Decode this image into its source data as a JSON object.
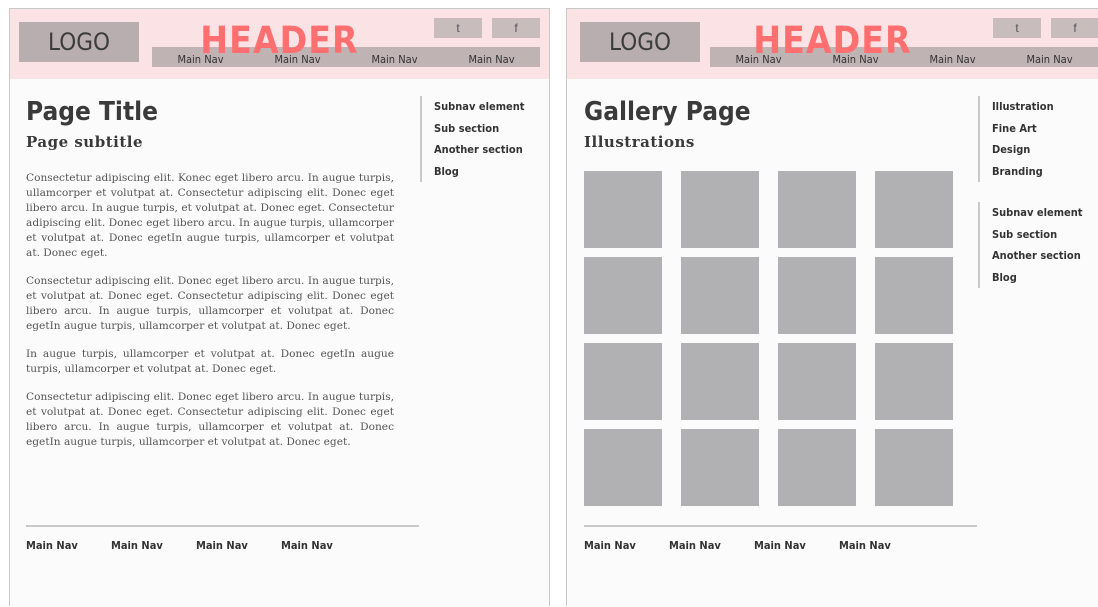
{
  "colors": {
    "header_bg": "#fbe3e5",
    "header_word": "#ff6f6f",
    "logo_bg": "#b9aeaf",
    "tile": "#b1b1b3"
  },
  "page_a": {
    "header": {
      "logo": "LOGO",
      "title": "HEADER",
      "nav": [
        "Main Nav",
        "Main Nav",
        "Main Nav",
        "Main Nav"
      ],
      "social": [
        "t",
        "f"
      ]
    },
    "title": "Page Title",
    "subtitle": "Page subtitle",
    "paragraphs": [
      "Consectetur adipiscing elit. Konec eget libero arcu. In augue turpis, ullamcorper et volutpat at. Consectetur adipiscing elit. Donec eget libero arcu. In augue turpis, et volutpat at. Donec eget. Consectetur adipiscing elit. Donec eget libero arcu. In augue turpis, ullamcorper et volutpat at. Donec egetIn augue turpis, ullamcorper et volutpat at. Donec eget.",
      "Consectetur adipiscing elit. Donec eget libero arcu. In augue turpis, et volutpat at. Donec eget. Consectetur adipiscing elit. Donec eget libero arcu. In augue turpis, ullamcorper et volutpat at. Donec egetIn augue turpis, ullamcorper et volutpat at. Donec eget.",
      "In augue turpis, ullamcorper et volutpat at. Donec egetIn augue turpis, ullamcorper et volutpat at. Donec eget.",
      "Consectetur adipiscing elit. Donec eget libero arcu. In augue turpis, et volutpat at. Donec eget. Consectetur adipiscing elit. Donec eget libero arcu. In augue turpis, ullamcorper et volutpat at. Donec egetIn augue turpis, ullamcorper et volutpat at. Donec eget."
    ],
    "subnav": [
      "Subnav element",
      "Sub section",
      "Another section",
      "Blog"
    ],
    "footer_nav": [
      "Main Nav",
      "Main Nav",
      "Main Nav",
      "Main Nav"
    ]
  },
  "page_b": {
    "header": {
      "logo": "LOGO",
      "title": "HEADER",
      "nav": [
        "Main Nav",
        "Main Nav",
        "Main Nav",
        "Main Nav"
      ],
      "social": [
        "t",
        "f"
      ]
    },
    "title": "Gallery Page",
    "subtitle": "Illustrations",
    "category_nav": [
      "Illustration",
      "Fine Art",
      "Design",
      "Branding"
    ],
    "subnav": [
      "Subnav element",
      "Sub section",
      "Another section",
      "Blog"
    ],
    "footer_nav": [
      "Main Nav",
      "Main Nav",
      "Main Nav",
      "Main Nav"
    ]
  }
}
